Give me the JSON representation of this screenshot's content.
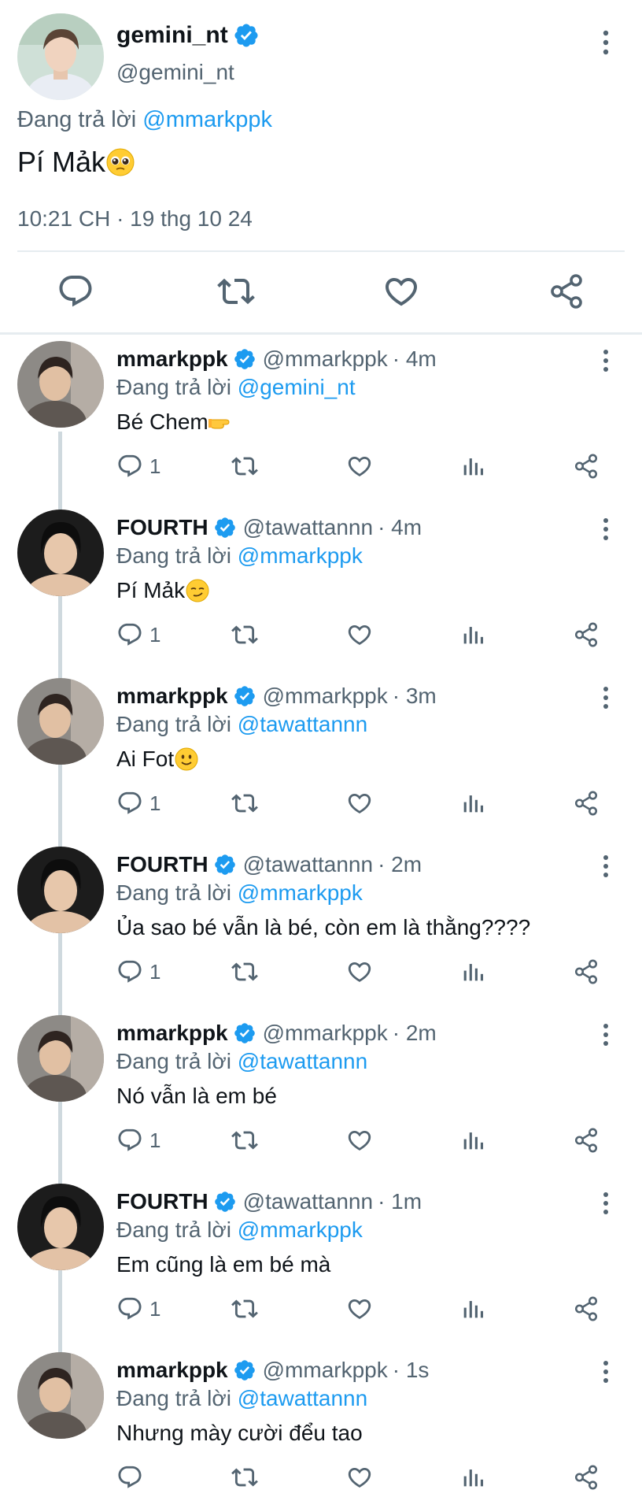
{
  "main": {
    "name": "gemini_nt",
    "handle": "@gemini_nt",
    "replying_prefix": "Đang trả lời",
    "replying_to": "@mmarkppk",
    "text": "Pí Mảk",
    "emoji": "pleading-face",
    "timestamp": "10:21 CH · 19 thg 10 24"
  },
  "replies": [
    {
      "name": "mmarkppk",
      "handle": "@mmarkppk",
      "time": "· 4m",
      "replying_prefix": "Đang trả lời",
      "replying_to": "@gemini_nt",
      "text": "Bé Chem",
      "emoji": "pointing-hand",
      "reply_count": "1"
    },
    {
      "name": "FOURTH",
      "handle": "@tawattannn",
      "time": "· 4m",
      "replying_prefix": "Đang trả lời",
      "replying_to": "@mmarkppk",
      "text": "Pí Mảk",
      "emoji": "smirking-face",
      "reply_count": "1"
    },
    {
      "name": "mmarkppk",
      "handle": "@mmarkppk",
      "time": "· 3m",
      "replying_prefix": "Đang trả lời",
      "replying_to": "@tawattannn",
      "text": "Ai Fot",
      "emoji": "slightly-smiling-face",
      "reply_count": "1"
    },
    {
      "name": "FOURTH",
      "handle": "@tawattannn",
      "time": "· 2m",
      "replying_prefix": "Đang trả lời",
      "replying_to": "@mmarkppk",
      "text": "Ủa sao bé vẫn là bé, còn em là thằng????",
      "emoji": "",
      "reply_count": "1"
    },
    {
      "name": "mmarkppk",
      "handle": "@mmarkppk",
      "time": "· 2m",
      "replying_prefix": "Đang trả lời",
      "replying_to": "@tawattannn",
      "text": "Nó vẫn là em bé",
      "emoji": "",
      "reply_count": "1"
    },
    {
      "name": "FOURTH",
      "handle": "@tawattannn",
      "time": "· 1m",
      "replying_prefix": "Đang trả lời",
      "replying_to": "@mmarkppk",
      "text": "Em cũng là em bé mà",
      "emoji": "",
      "reply_count": "1"
    },
    {
      "name": "mmarkppk",
      "handle": "@mmarkppk",
      "time": "· 1s",
      "replying_prefix": "Đang trả lời",
      "replying_to": "@tawattannn",
      "text": "Nhưng mày cười đểu tao",
      "emoji": "",
      "reply_count": ""
    }
  ],
  "colors": {
    "link": "#1d9bf0",
    "secondary_text": "#536471",
    "icon": "#536471",
    "verified": "#1d9bf0",
    "divider": "#e6ecf0"
  },
  "icons": {
    "reply": "reply-icon",
    "retweet": "retweet-icon",
    "like": "heart-icon",
    "views": "views-icon",
    "share": "share-icon",
    "more": "more-vertical-icon",
    "verified": "verified-badge-icon"
  }
}
